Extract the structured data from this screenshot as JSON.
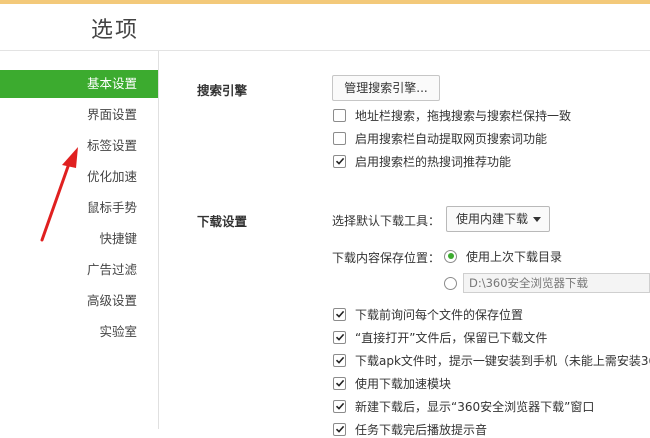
{
  "header": {
    "title": "选项"
  },
  "sidebar": {
    "items": [
      {
        "label": "基本设置",
        "active": true
      },
      {
        "label": "界面设置"
      },
      {
        "label": "标签设置"
      },
      {
        "label": "优化加速"
      },
      {
        "label": "鼠标手势"
      },
      {
        "label": "快捷键"
      },
      {
        "label": "广告过滤"
      },
      {
        "label": "高级设置"
      },
      {
        "label": "实验室"
      }
    ]
  },
  "search": {
    "section_label": "搜索引擎",
    "manage_button": "管理搜索引擎...",
    "options": [
      {
        "label": "地址栏搜索，拖拽搜索与搜索栏保持一致",
        "checked": false
      },
      {
        "label": "启用搜索栏自动提取网页搜索词功能",
        "checked": false
      },
      {
        "label": "启用搜索栏的热搜词推荐功能",
        "checked": true
      }
    ]
  },
  "download": {
    "section_label": "下载设置",
    "tool_label": "选择默认下载工具：",
    "tool_value": "使用内建下载",
    "location_label": "下载内容保存位置：",
    "radio_last": "使用上次下载目录",
    "radio_last_selected": true,
    "path_value": "D:\\360安全浏览器下载",
    "options": [
      {
        "label": "下载前询问每个文件的保存位置",
        "checked": true
      },
      {
        "label": "“直接打开”文件后，保留已下载文件",
        "checked": true
      },
      {
        "label": "下载apk文件时，提示一键安装到手机（未能上需安装36",
        "checked": true
      },
      {
        "label": "使用下载加速模块",
        "checked": true
      },
      {
        "label": "新建下载后，显示“360安全浏览器下载”窗口",
        "checked": true
      },
      {
        "label": "任务下载完后播放提示音",
        "checked": true
      }
    ]
  },
  "colors": {
    "accent": "#3cab2f",
    "annotation_arrow": "#e02020"
  }
}
